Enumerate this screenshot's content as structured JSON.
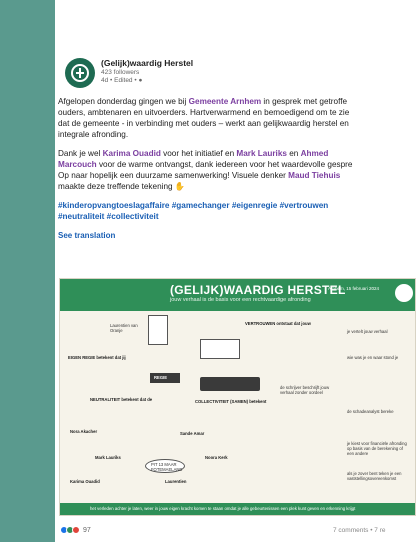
{
  "post": {
    "author": "(Gelijk)waardig Herstel",
    "followers": "423 followers",
    "timestamp": "4d • Edited • ",
    "paragraph1": {
      "line1_a": "Afgelopen donderdag gingen we bij ",
      "line1_mention": "Gemeente Arnhem",
      "line1_b": " in gesprek met getroffe",
      "line2": "ouders, ambtenaren en uitvoerders. Hartverwarmend en bemoedigend om te zie",
      "line3": "dat de gemeente - in verbinding met ouders – werkt aan gelijkwaardig herstel en",
      "line4": "integrale afronding."
    },
    "paragraph2": {
      "line1_a": "Dank je wel ",
      "mention1": "Karima Ouadid",
      "line1_b": " voor het initiatief en ",
      "mention2": "Mark Lauriks",
      "line1_c": " en ",
      "mention3": "Ahmed",
      "mention3b": "Marcouch",
      "line2_b": " voor de warme ontvangst, dank iedereen voor het waardevolle gespre",
      "line3_a": "Op naar hopelijk een duurzame samenwerking! Visuele denker ",
      "mention4": "Maud Tiehuis",
      "line4": "maakte deze treffende tekening"
    },
    "hashtags_line1": "#kinderopvangtoeslagaffaire #gamechanger #eigenregie #vertrouwen",
    "hashtags_line2": "#neutraliteit #collectiviteit",
    "see_translation": "See translation"
  },
  "sketch": {
    "title": "(GELIJK)WAARDIG HERSTEL",
    "subtitle": "jouw verhaal is de basis voor een rechtvaardige afronding",
    "date": "Arnhem, 15 februari 2024",
    "notes": {
      "n1": "Laurentien van Oranje",
      "n2": "EIGEN REGIE betekent dat jij",
      "n3": "VERTROUWEN ontstaat dat jouw",
      "n4": "je vertelt jouw verhaal",
      "n5": "wie was je en waar stond je",
      "n6": "NEUTRALITEIT betekent dat de",
      "n7": "COLLECTIVITEIT (SAMEN) betekent",
      "n8": "de schrijver beschrijft jouw verhaal zonder oordeel",
      "n9": "de schadeanalyst bereke",
      "n10": "Nora Akacher",
      "n11": "Sande Amar",
      "n12": "Mark Lauriks",
      "n13": "Noora Kerk",
      "n14": "Karima Ouadid",
      "n15": "Laurentien",
      "n16": "je kiest voor financiële afronding op basis van de berekening of een andere",
      "n17": "als je zover bent teken je een vaststellingsovereenkomst",
      "n18": "REGIE",
      "n19": "PIT 13 MAAR FOTEMAELAND"
    },
    "footer": "het verleden achter je laten, weer in jouw eigen kracht komen te staan omdat je alle gebeurtenissen een plek kunt geven en erkenning krijgt"
  },
  "social": {
    "reaction_count": "97",
    "comments_reposts": "7 comments • 7 re"
  },
  "colors": {
    "mention": "#7b3fa0",
    "hashtag": "#1a5fb4",
    "brand_green": "#2f8f58",
    "background": "#5a9a8e"
  }
}
